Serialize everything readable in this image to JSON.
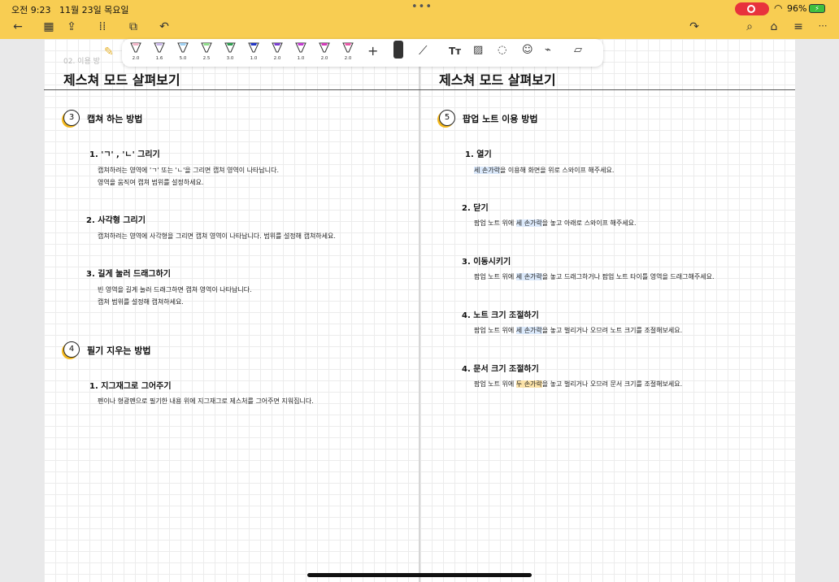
{
  "status": {
    "time": "오전 9:23",
    "date": "11월 23일 목요일",
    "battery": "96%"
  },
  "nav": {
    "back_icon": "←",
    "grid_icon": "▦",
    "export_icon": "⇪",
    "apps_icon": "⁞⁞",
    "scan_icon": "⧉",
    "undo_icon": "↶",
    "redo_icon": "↷",
    "search_icon": "⌕",
    "bookmark_icon": "⌂",
    "more_icon": "≡"
  },
  "toolbar": {
    "pens": [
      {
        "size": "2.0",
        "color": "#f2b5c8"
      },
      {
        "size": "1.6",
        "color": "#c9b6e8"
      },
      {
        "size": "5.0",
        "color": "#9fd0f2"
      },
      {
        "size": "2.5",
        "color": "#8fdc8a"
      },
      {
        "size": "3.0",
        "color": "#2d9b4e"
      },
      {
        "size": "1.0",
        "color": "#2437c7"
      },
      {
        "size": "2.0",
        "color": "#7a3fd1"
      },
      {
        "size": "1.0",
        "color": "#c43bd2"
      },
      {
        "size": "2.0",
        "color": "#d33ab8"
      },
      {
        "size": "2.0",
        "color": "#e85aa8"
      }
    ],
    "add_label": "+",
    "text_tool": "Tт"
  },
  "doc": {
    "breadcrumb": "02. 이용 방",
    "left": {
      "title": "제스쳐 모드 살펴보기",
      "sections": [
        {
          "num": "3",
          "heading": "캡쳐 하는 방법",
          "items": [
            {
              "label": "1. 'ㄱ' , 'ㄴ' 그리기",
              "lines": [
                "캡쳐하려는 영역에 'ㄱ' 또는 'ㄴ'을 그리면 캡쳐 영역이 나타납니다.",
                "영역을 움직여 캡쳐 범위를 설정하세요."
              ]
            },
            {
              "label": "2. 사각형 그리기",
              "lines": [
                "캡쳐하려는 영역에 사각형을 그리면 캡쳐 영역이 나타납니다. 범위를 설정해 캡쳐하세요."
              ]
            },
            {
              "label": "3. 길게 눌러 드래그하기",
              "lines": [
                "빈 영역을 길게 눌러 드래그하면 캡쳐 영역이 나타납니다.",
                "캡쳐 범위를 설정해 캡쳐하세요."
              ]
            }
          ]
        },
        {
          "num": "4",
          "heading": "필기 지우는 방법",
          "items": [
            {
              "label": "1. 지그재그로 그어주기",
              "lines": [
                "펜이나 형광펜으로 필기한 내용 위에 지그재그로 제스처를 그어주면 지워집니다."
              ]
            }
          ]
        }
      ]
    },
    "right": {
      "title": "제스쳐 모드 살펴보기",
      "section": {
        "num": "5",
        "heading": "팝업 노트 이용 방법"
      },
      "items": [
        {
          "label": "1. 열기",
          "pre": "",
          "hl": "세 손가락",
          "post": "을 이용해 화면을 위로 스와이프 해주세요."
        },
        {
          "label": "2. 닫기",
          "pre": "팝업 노트 위에 ",
          "hl": "세 손가락",
          "post": "을 놓고 아래로 스와이프 해주세요."
        },
        {
          "label": "3. 이동시키기",
          "pre": "팝업 노트 위에 ",
          "hl": "세 손가락",
          "post": "을 놓고 드래그하거나 팝업 노트 타이틀 영역을 드래그해주세요."
        },
        {
          "label": "4. 노트 크기 조절하기",
          "pre": "팝업 노트 위에 ",
          "hl": "세 손가락",
          "post": "을 놓고 벌리거나 오므려 노트 크기를 조절해보세요."
        },
        {
          "label": "4. 문서 크기 조절하기",
          "pre": "팝업 노트 위에 ",
          "hl": "두 손가락",
          "post": "을 놓고 벌리거나 오므려 문서 크기를 조절해보세요."
        }
      ]
    }
  }
}
